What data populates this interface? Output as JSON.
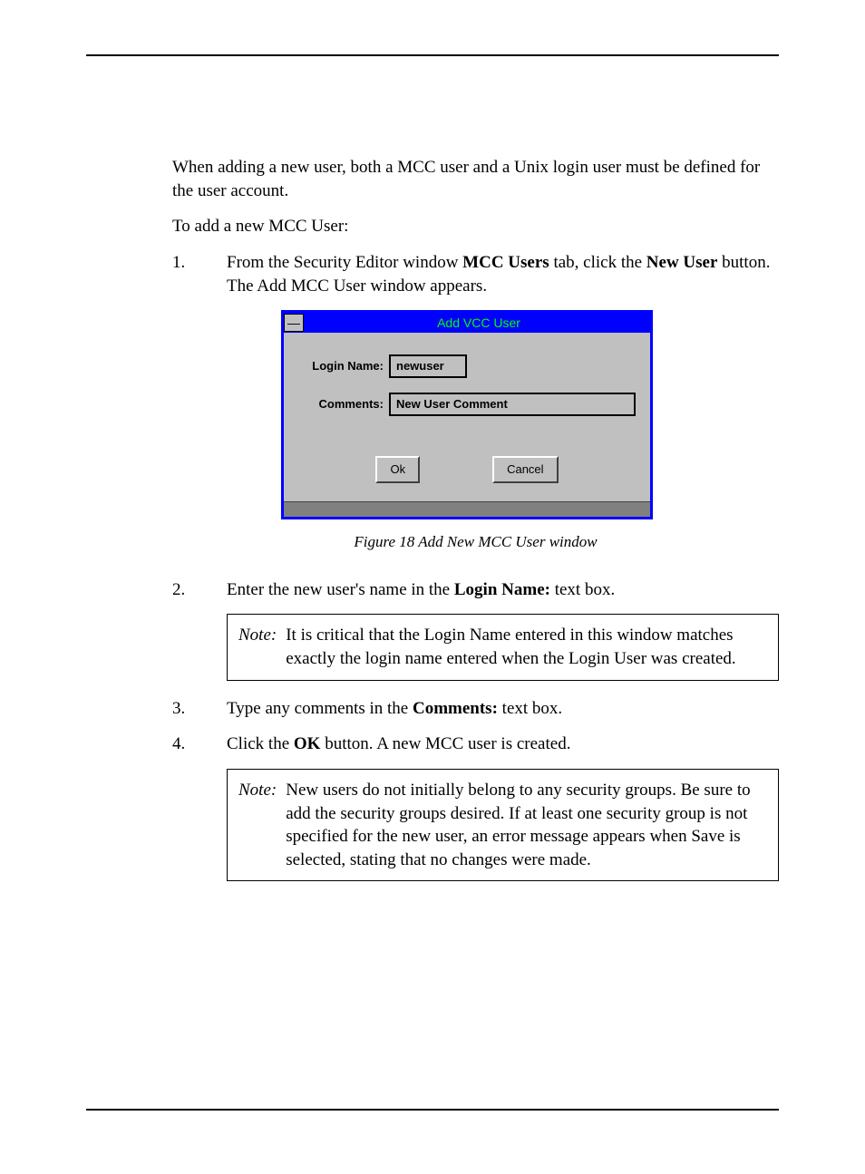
{
  "intro1": "When adding a new user, both a MCC user and a Unix login user must be defined for the user account.",
  "intro2": "To add a new MCC User:",
  "steps": {
    "1": {
      "num": "1.",
      "pre": "From the Security Editor window ",
      "b1": "MCC Users",
      "mid": " tab, click the ",
      "b2": "New User",
      "post": " button. The Add MCC User window appears."
    },
    "2": {
      "num": "2.",
      "pre": "Enter the new user's name in the ",
      "b1": "Login Name:",
      "post": " text box."
    },
    "3": {
      "num": "3.",
      "pre": "Type any comments in the ",
      "b1": "Comments:",
      "post": " text box."
    },
    "4": {
      "num": "4.",
      "pre": "Click the ",
      "b1": "OK",
      "post": " button. A new MCC user is created."
    }
  },
  "dialog": {
    "sys_icon": "—",
    "title": "Add VCC User",
    "login_label": "Login Name:",
    "login_value": "newuser",
    "comments_label": "Comments:",
    "comments_value": "New User Comment",
    "ok": "Ok",
    "cancel": "Cancel"
  },
  "figure_caption": "Figure 18 Add New MCC User window",
  "note1": {
    "lead": "Note:",
    "text": "It is critical that the Login Name entered in this window matches exactly the login name entered when the Login User was created."
  },
  "note2": {
    "lead": "Note:",
    "text": "New users do not initially belong to any security groups. Be sure to add the security groups desired. If at least one security group is not specified for the new user, an error message appears when Save is selected, stating that no changes were made."
  }
}
